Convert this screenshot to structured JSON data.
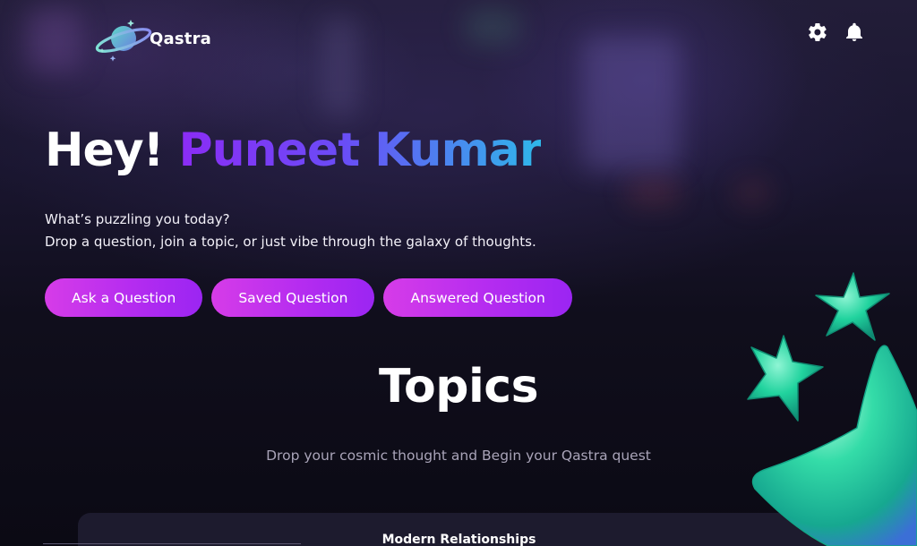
{
  "header": {
    "brand": "Qastra",
    "logo_icon": "planet-logo-icon",
    "settings_icon": "gear-icon",
    "notifications_icon": "bell-icon"
  },
  "hero": {
    "greeting_prefix": "Hey!",
    "user_name": "Puneet Kumar",
    "line1": "What’s puzzling you today?",
    "line2": "Drop a question, join a topic, or just vibe through the galaxy of thoughts."
  },
  "actions": {
    "ask_label": "Ask a Question",
    "saved_label": "Saved Question",
    "answered_label": "Answered Question"
  },
  "topics": {
    "title": "Topics",
    "subtitle": "Drop your cosmic thought and Begin your Qastra quest",
    "cards": [
      {
        "title": "Modern Relationships"
      }
    ]
  },
  "colors": {
    "background": "#0d0c18",
    "button_gradient_start": "#d63ce8",
    "button_gradient_end": "#9b25f2",
    "name_gradient_start": "#8b2cf5",
    "name_gradient_end": "#2fb8ea",
    "star_green": "#22d3a0"
  }
}
